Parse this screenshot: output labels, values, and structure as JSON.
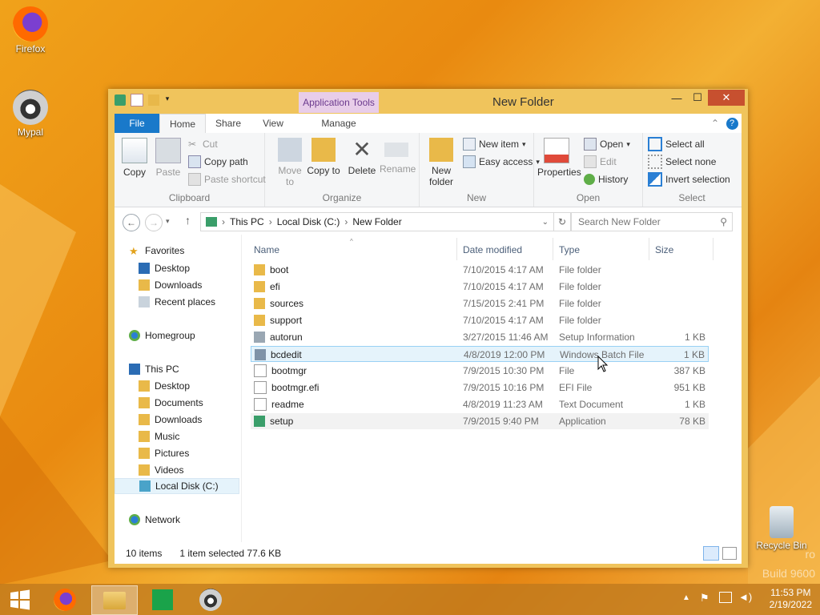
{
  "desktop": {
    "icons": [
      {
        "label": "Firefox"
      },
      {
        "label": "Mypal"
      },
      {
        "label": "Recycle Bin"
      }
    ],
    "watermark": {
      "line1": "ro",
      "line2": "Build 9600"
    }
  },
  "window": {
    "title": "New Folder",
    "context_tab": "Application Tools",
    "controls": {
      "minimize": "—",
      "maximize": "☐",
      "close": "✕"
    }
  },
  "ribbon": {
    "tabs": [
      "File",
      "Home",
      "Share",
      "View",
      "Manage"
    ],
    "clipboard": {
      "copy": "Copy",
      "paste": "Paste",
      "cut": "Cut",
      "copy_path": "Copy path",
      "paste_shortcut": "Paste shortcut",
      "label": "Clipboard"
    },
    "organize": {
      "move_to": "Move to",
      "copy_to": "Copy to",
      "delete": "Delete",
      "rename": "Rename",
      "label": "Organize"
    },
    "new": {
      "new_folder": "New folder",
      "new_item": "New item",
      "easy_access": "Easy access",
      "label": "New"
    },
    "open": {
      "properties": "Properties",
      "open": "Open",
      "edit": "Edit",
      "history": "History",
      "label": "Open"
    },
    "select": {
      "select_all": "Select all",
      "select_none": "Select none",
      "invert": "Invert selection",
      "label": "Select"
    }
  },
  "address": {
    "crumbs": [
      "This PC",
      "Local Disk (C:)",
      "New Folder"
    ],
    "search_placeholder": "Search New Folder"
  },
  "nav": {
    "favorites": "Favorites",
    "fav_items": [
      "Desktop",
      "Downloads",
      "Recent places"
    ],
    "homegroup": "Homegroup",
    "this_pc": "This PC",
    "pc_items": [
      "Desktop",
      "Documents",
      "Downloads",
      "Music",
      "Pictures",
      "Videos",
      "Local Disk (C:)"
    ],
    "network": "Network"
  },
  "columns": [
    "Name",
    "Date modified",
    "Type",
    "Size"
  ],
  "files": [
    {
      "name": "boot",
      "date": "7/10/2015 4:17 AM",
      "type": "File folder",
      "size": ""
    },
    {
      "name": "efi",
      "date": "7/10/2015 4:17 AM",
      "type": "File folder",
      "size": ""
    },
    {
      "name": "sources",
      "date": "7/15/2015 2:41 PM",
      "type": "File folder",
      "size": ""
    },
    {
      "name": "support",
      "date": "7/10/2015 4:17 AM",
      "type": "File folder",
      "size": ""
    },
    {
      "name": "autorun",
      "date": "3/27/2015 11:46 AM",
      "type": "Setup Information",
      "size": "1 KB"
    },
    {
      "name": "bcdedit",
      "date": "4/8/2019 12:00 PM",
      "type": "Windows Batch File",
      "size": "1 KB"
    },
    {
      "name": "bootmgr",
      "date": "7/9/2015 10:30 PM",
      "type": "File",
      "size": "387 KB"
    },
    {
      "name": "bootmgr.efi",
      "date": "7/9/2015 10:16 PM",
      "type": "EFI File",
      "size": "951 KB"
    },
    {
      "name": "readme",
      "date": "4/8/2019 11:23 AM",
      "type": "Text Document",
      "size": "1 KB"
    },
    {
      "name": "setup",
      "date": "7/9/2015 9:40 PM",
      "type": "Application",
      "size": "78 KB"
    }
  ],
  "status": {
    "count": "10 items",
    "selected": "1 item selected  77.6 KB"
  },
  "taskbar": {
    "time": "11:53 PM",
    "date": "2/19/2022"
  },
  "colors": {
    "accent": "#1979ca",
    "titlebar": "#f0c45c",
    "context": "#e8cde9"
  }
}
